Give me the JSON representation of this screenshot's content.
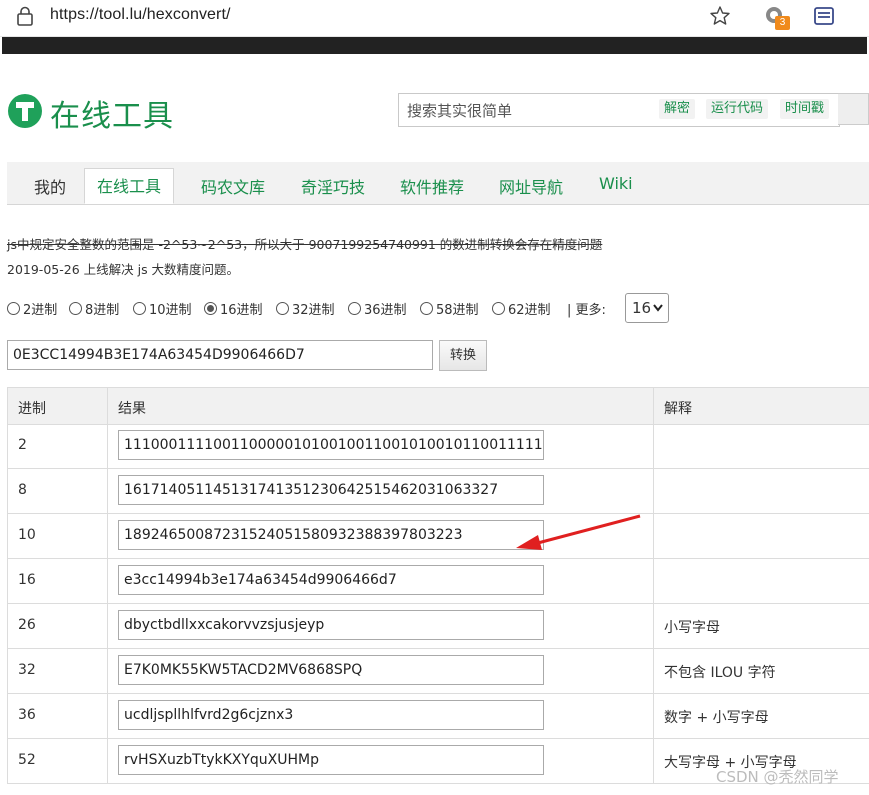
{
  "browser": {
    "url": "https://tool.lu/hexconvert/",
    "ext_badge": "3"
  },
  "site": {
    "logo_text": "在线工具",
    "search_placeholder": "搜索其实很简单",
    "search_tags": [
      "解密",
      "运行代码",
      "时间戳"
    ],
    "brand_color": "#1a8f4c"
  },
  "nav": {
    "items": [
      "我的",
      "在线工具",
      "码农文库",
      "奇淫巧技",
      "软件推荐",
      "网址导航",
      "Wiki"
    ],
    "active": "在线工具"
  },
  "notices": {
    "line1": "js中规定安全整数的范围是 -2^53~2^53，所以大于 9007199254740991 的数进制转换会存在精度问题",
    "line2": "2019-05-26 上线解决 js 大数精度问题。"
  },
  "base_options": {
    "radios": [
      {
        "label": "2进制",
        "selected": false
      },
      {
        "label": "8进制",
        "selected": false
      },
      {
        "label": "10进制",
        "selected": false
      },
      {
        "label": "16进制",
        "selected": true
      },
      {
        "label": "32进制",
        "selected": false
      },
      {
        "label": "36进制",
        "selected": false
      },
      {
        "label": "58进制",
        "selected": false
      },
      {
        "label": "62进制",
        "selected": false
      }
    ],
    "more_label": "| 更多:",
    "more_value": "16"
  },
  "input": {
    "value": "0E3CC14994B3E174A63454D9906466D7",
    "convert_label": "转换"
  },
  "table": {
    "headers": [
      "进制",
      "结果",
      "解释"
    ],
    "rows": [
      {
        "base": "2",
        "result": "11100011110011000001010010011001010010110011111",
        "note": ""
      },
      {
        "base": "8",
        "result": "1617140511451317413512306425154620310633​27",
        "note": ""
      },
      {
        "base": "10",
        "result": "18924650087231524051580932388397803223",
        "note": ""
      },
      {
        "base": "16",
        "result": "e3cc14994b3e174a63454d9906466d7",
        "note": ""
      },
      {
        "base": "26",
        "result": "dbyctbdllxxcakorvvzsjusjeyp",
        "note": "小写字母"
      },
      {
        "base": "32",
        "result": "E7K0MK55KW5TACD2MV6868SPQ",
        "note": "不包含 ILOU 字符"
      },
      {
        "base": "36",
        "result": "ucdljspllhlfvrd2g6cjznx3",
        "note": "数字 + 小写字母"
      },
      {
        "base": "52",
        "result": "rvHSXuzbTtykKXYquXUHMp",
        "note": "大写字母 + 小写字母"
      }
    ]
  },
  "watermark": "CSDN @秃然同学"
}
